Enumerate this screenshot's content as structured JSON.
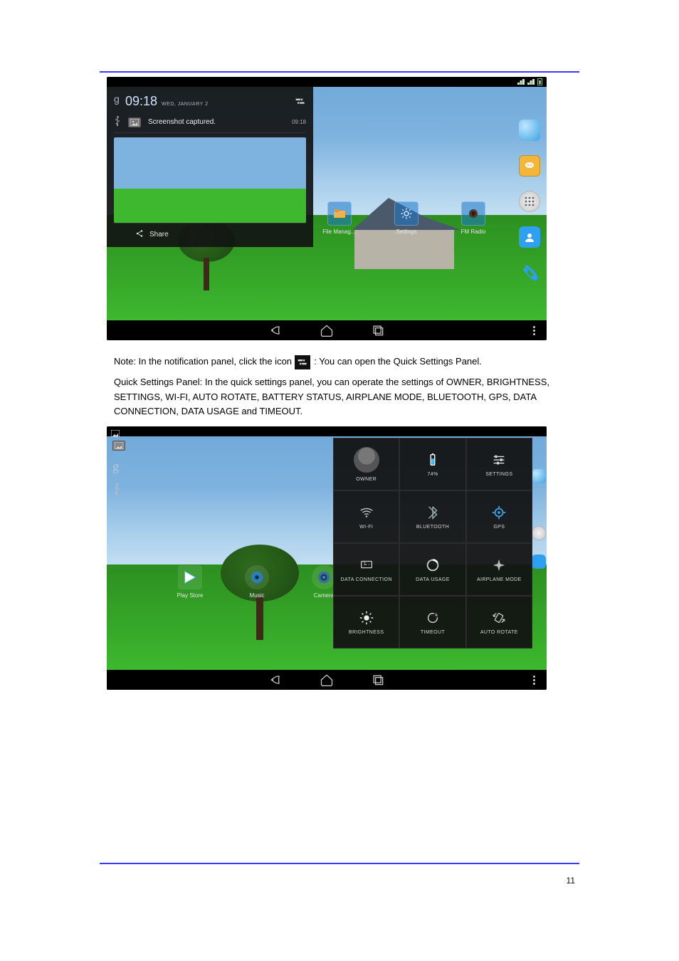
{
  "doc": {
    "page_number": "11",
    "intro": "Note: In the notification panel, click the icon ",
    "intro_tail": " : You can open the Quick Settings Panel.",
    "caption2": "Quick Settings Panel: In the quick settings panel, you can operate the settings of OWNER, BRIGHTNESS, SETTINGS, WI-FI, AUTO ROTATE, BATTERY STATUS, AIRPLANE MODE, BLUETOOTH, GPS, DATA CONNECTION, DATA USAGE and TIMEOUT."
  },
  "shot1": {
    "time": "09:18",
    "date": "WED, JANUARY 2",
    "notif_title": "Screenshot captured.",
    "notif_time": "09:18",
    "share": "Share",
    "apps": [
      {
        "label": "File Manag…"
      },
      {
        "label": "Settings"
      },
      {
        "label": "FM Radio"
      }
    ]
  },
  "shot2": {
    "apps": [
      {
        "label": "Play Store"
      },
      {
        "label": "Music"
      },
      {
        "label": "Camera"
      }
    ],
    "tiles": {
      "owner": "OWNER",
      "battery_pct": "74%",
      "settings": "SETTINGS",
      "wifi": "WI-FI",
      "bluetooth": "BLUETOOTH",
      "gps": "GPS",
      "data_conn": "DATA CONNECTION",
      "data_usage": "DATA USAGE",
      "airplane": "AIRPLANE MODE",
      "brightness": "BRIGHTNESS",
      "timeout": "TIMEOUT",
      "auto_rotate": "AUTO ROTATE"
    }
  }
}
